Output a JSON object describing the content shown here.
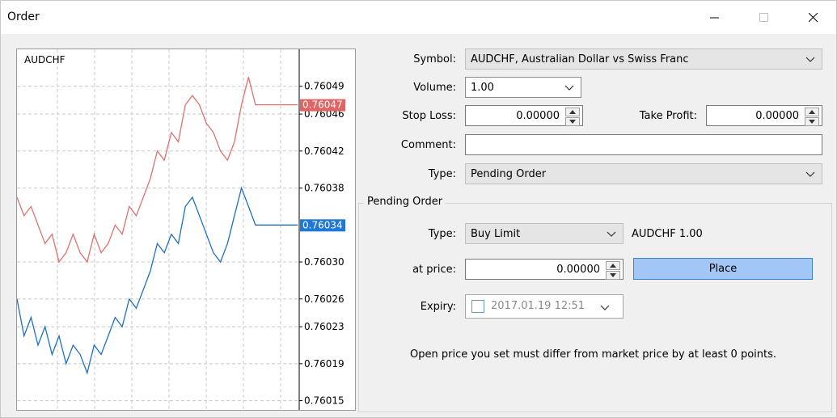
{
  "window": {
    "title": "Order"
  },
  "chart": {
    "symbol": "AUDCHF",
    "price_labels": [
      "0.76049",
      "0.76046",
      "0.76042",
      "0.76038",
      "0.76030",
      "0.76026",
      "0.76023",
      "0.76019",
      "0.76015"
    ],
    "ask_tag": "0.76047",
    "bid_tag": "0.76034",
    "colors": {
      "ask": "#e07070",
      "bid": "#1f6fc4",
      "tag_ask": "#e06464",
      "tag_bid": "#1e78d6"
    }
  },
  "chart_data": {
    "type": "line",
    "title": "AUDCHF",
    "ylim": [
      0.76014,
      0.76053
    ],
    "series": [
      {
        "values": [
          0.76037,
          0.76035,
          0.76036,
          0.76034,
          0.76032,
          0.76033,
          0.7603,
          0.76031,
          0.76033,
          0.76031,
          0.7603,
          0.76033,
          0.76031,
          0.76032,
          0.76034,
          0.76033,
          0.76036,
          0.76035,
          0.76037,
          0.76039,
          0.76042,
          0.76041,
          0.76044,
          0.76043,
          0.76047,
          0.76048,
          0.76047,
          0.76045,
          0.76044,
          0.76042,
          0.76041,
          0.76043,
          0.76047,
          0.7605,
          0.76047,
          0.76047,
          0.76047,
          0.76047,
          0.76047,
          0.76047,
          0.76047
        ]
      },
      {
        "values": [
          0.76026,
          0.76022,
          0.76024,
          0.76021,
          0.76023,
          0.7602,
          0.76022,
          0.76019,
          0.76021,
          0.7602,
          0.76018,
          0.76021,
          0.7602,
          0.76022,
          0.76024,
          0.76023,
          0.76026,
          0.76025,
          0.76027,
          0.76029,
          0.76032,
          0.76031,
          0.76033,
          0.76032,
          0.76036,
          0.76037,
          0.76035,
          0.76033,
          0.76031,
          0.7603,
          0.76032,
          0.76035,
          0.76038,
          0.76036,
          0.76034,
          0.76034,
          0.76034,
          0.76034,
          0.76034,
          0.76034,
          0.76034
        ]
      }
    ]
  },
  "form": {
    "symbol_label": "Symbol:",
    "symbol_value": "AUDCHF, Australian Dollar vs Swiss Franc",
    "volume_label": "Volume:",
    "volume_value": "1.00",
    "stop_loss_label": "Stop Loss:",
    "stop_loss_value": "0.00000",
    "take_profit_label": "Take Profit:",
    "take_profit_value": "0.00000",
    "comment_label": "Comment:",
    "comment_value": "",
    "type_label": "Type:",
    "type_value": "Pending Order"
  },
  "pending": {
    "group_title": "Pending Order",
    "type_label": "Type:",
    "type_value": "Buy Limit",
    "type_info": "AUDCHF 1.00",
    "at_price_label": "at price:",
    "at_price_value": "0.00000",
    "place_label": "Place",
    "expiry_label": "Expiry:",
    "expiry_value": "2017.01.19 12:51",
    "note": "Open price you set must differ from market price by at least 0 points."
  }
}
